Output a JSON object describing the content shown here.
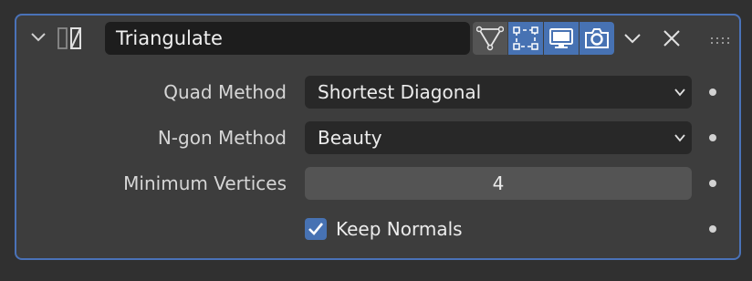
{
  "modifier": {
    "name": "Triangulate",
    "icons": {
      "collapse": "chevron-down-icon",
      "type": "triangulate-modifier-icon",
      "on_cage": "on-cage-icon",
      "edit_mode": "edit-mode-icon",
      "viewport": "viewport-display-icon",
      "render": "render-camera-icon",
      "dropdown": "chevron-down-icon",
      "close": "close-icon",
      "drag": "drag-handle-icon"
    },
    "toggles": {
      "on_cage": false,
      "edit_mode": true,
      "viewport": true,
      "render": true
    }
  },
  "fields": {
    "quad_method": {
      "label": "Quad Method",
      "value": "Shortest Diagonal"
    },
    "ngon_method": {
      "label": "N-gon Method",
      "value": "Beauty"
    },
    "min_vertices": {
      "label": "Minimum Vertices",
      "value": "4"
    },
    "keep_normals": {
      "label": "Keep Normals",
      "checked": true
    }
  },
  "colors": {
    "accent": "#4772b3",
    "panel_border": "#4a72b8",
    "panel_bg": "#3d3d3d"
  }
}
